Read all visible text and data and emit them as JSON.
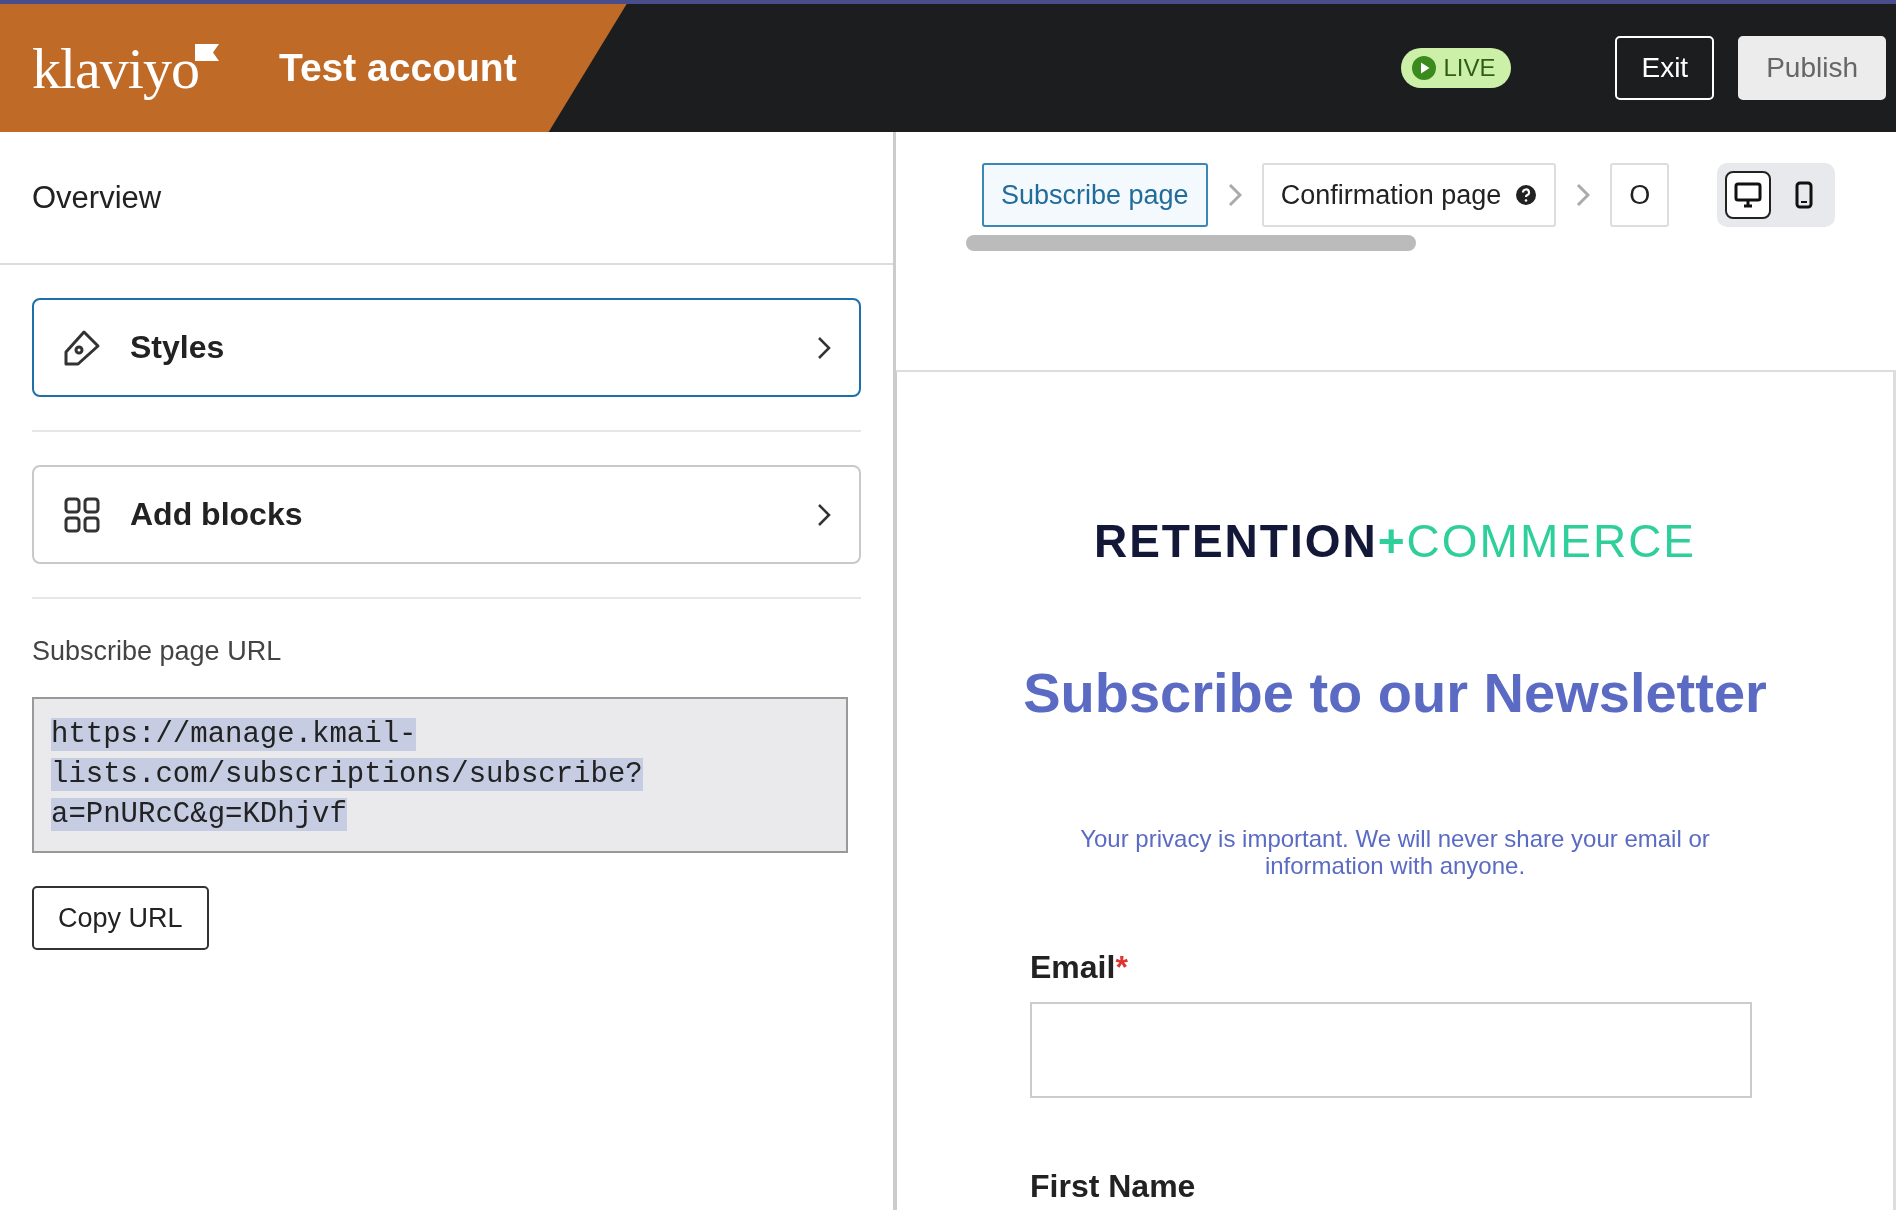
{
  "header": {
    "logo": "klaviyo",
    "account": "Test account",
    "live_badge": "LIVE",
    "buttons": [
      {
        "label": "Exit",
        "disabled": false
      },
      {
        "label": "Publish",
        "disabled": true
      }
    ]
  },
  "sidebar": {
    "title": "Overview",
    "items": [
      {
        "label": "Styles",
        "kind": "styles",
        "selected": true
      },
      {
        "label": "Add blocks",
        "kind": "blocks",
        "selected": false
      }
    ],
    "url_label": "Subscribe page URL",
    "url_value": "https://manage.kmail-lists.com/subscriptions/subscribe?a=PnURcC&g=KDhjvf",
    "copy_button": "Copy URL"
  },
  "page_tabs": [
    {
      "label": "Subscribe page",
      "selected": true,
      "help": false
    },
    {
      "label": "Confirmation page",
      "selected": false,
      "help": true
    },
    {
      "label": "O",
      "selected": false,
      "help": false
    }
  ],
  "device_toggle": [
    {
      "kind": "desktop",
      "selected": true
    },
    {
      "kind": "mobile",
      "selected": false
    }
  ],
  "preview": {
    "brand": {
      "part_1": "RETENTION",
      "joiner": "+",
      "part_2": "COMMERCE"
    },
    "heading": "Subscribe to our Newsletter",
    "privacy_note": "Your privacy is important. We will never share your email or information with anyone.",
    "fields": [
      {
        "label": "Email",
        "required_mark": "*"
      },
      {
        "label": "First Name"
      }
    ]
  }
}
